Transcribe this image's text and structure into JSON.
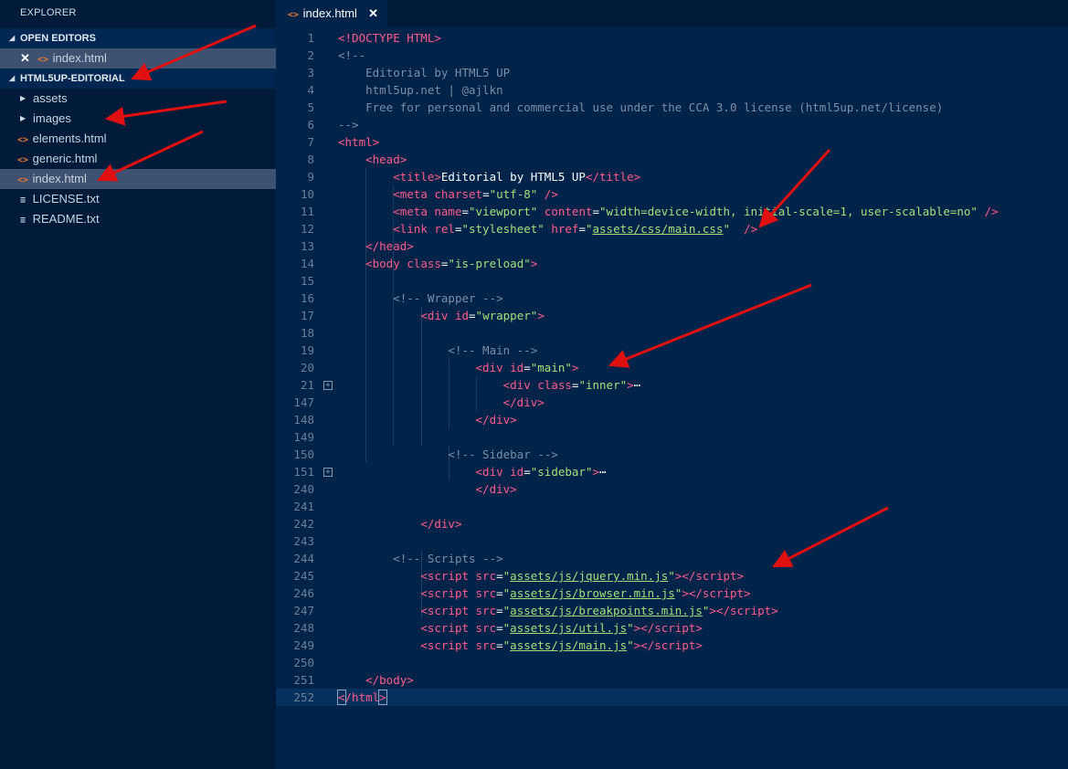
{
  "sidebar": {
    "title": "EXPLORER",
    "open_editors_label": "OPEN EDITORS",
    "open_editor_file": "index.html",
    "project_label": "HTML5UP-EDITORIAL",
    "folders": [
      "assets",
      "images"
    ],
    "files": [
      "elements.html",
      "generic.html",
      "index.html",
      "LICENSE.txt",
      "README.txt"
    ]
  },
  "tab": {
    "label": "index.html",
    "close": "✕"
  },
  "editor": {
    "lines": [
      {
        "n": "1",
        "html": "<span class='tg'>&lt;!DOCTYPE HTML&gt;</span>"
      },
      {
        "n": "2",
        "html": "<span class='cm'>&lt;!--</span>"
      },
      {
        "n": "3",
        "html": "<span class='cm'>    Editorial by HTML5 UP</span>"
      },
      {
        "n": "4",
        "html": "<span class='cm'>    html5up.net | @ajlkn</span>"
      },
      {
        "n": "5",
        "html": "<span class='cm'>    Free for personal and commercial use under the CCA 3.0 license (html5up.net/license)</span>"
      },
      {
        "n": "6",
        "html": "<span class='cm'>--&gt;</span>"
      },
      {
        "n": "7",
        "html": "<span class='tg'>&lt;html&gt;</span>"
      },
      {
        "n": "8",
        "html": "    <span class='tg'>&lt;head&gt;</span>"
      },
      {
        "n": "9",
        "html": "        <span class='tg'>&lt;title&gt;</span><span class='pl'>Editorial by HTML5 UP</span><span class='tg'>&lt;/title&gt;</span>"
      },
      {
        "n": "10",
        "html": "        <span class='tg'>&lt;meta </span><span class='at'>charset</span><span class='pl'>=</span><span class='st'>\"utf-8\"</span><span class='tg'> /&gt;</span>"
      },
      {
        "n": "11",
        "html": "        <span class='tg'>&lt;meta </span><span class='at'>name</span><span class='pl'>=</span><span class='st'>\"viewport\"</span> <span class='at'>content</span><span class='pl'>=</span><span class='st'>\"width=device-width, initial-scale=1, user-scalable=no\"</span><span class='tg'> /&gt;</span>"
      },
      {
        "n": "12",
        "html": "        <span class='tg'>&lt;link </span><span class='at'>rel</span><span class='pl'>=</span><span class='st'>\"stylesheet\"</span> <span class='at'>href</span><span class='pl'>=</span><span class='st'>\"</span><span class='lk'>assets/css/main.css</span><span class='st'>\"</span><span class='tg'>  /&gt;</span>"
      },
      {
        "n": "13",
        "html": "    <span class='tg'>&lt;/head&gt;</span>"
      },
      {
        "n": "14",
        "html": "    <span class='tg'>&lt;body </span><span class='at'>class</span><span class='pl'>=</span><span class='st'>\"is-preload\"</span><span class='tg'>&gt;</span>"
      },
      {
        "n": "15",
        "html": ""
      },
      {
        "n": "16",
        "html": "        <span class='cm'>&lt;!-- Wrapper --&gt;</span>"
      },
      {
        "n": "17",
        "html": "            <span class='tg'>&lt;div </span><span class='at'>id</span><span class='pl'>=</span><span class='st'>\"wrapper\"</span><span class='tg'>&gt;</span>"
      },
      {
        "n": "18",
        "html": ""
      },
      {
        "n": "19",
        "html": "                <span class='cm'>&lt;!-- Main --&gt;</span>"
      },
      {
        "n": "20",
        "html": "                    <span class='tg'>&lt;div </span><span class='at'>id</span><span class='pl'>=</span><span class='st'>\"main\"</span><span class='tg'>&gt;</span>"
      },
      {
        "n": "21",
        "fold": true,
        "html": "                        <span class='tg'>&lt;div </span><span class='at'>class</span><span class='pl'>=</span><span class='st'>\"inner\"</span><span class='tg'>&gt;</span><span class='dt'>⋯</span>"
      },
      {
        "n": "147",
        "html": "                        <span class='tg'>&lt;/div&gt;</span>"
      },
      {
        "n": "148",
        "html": "                    <span class='tg'>&lt;/div&gt;</span>"
      },
      {
        "n": "149",
        "html": ""
      },
      {
        "n": "150",
        "html": "                <span class='cm'>&lt;!-- Sidebar --&gt;</span>"
      },
      {
        "n": "151",
        "fold": true,
        "html": "                    <span class='tg'>&lt;div </span><span class='at'>id</span><span class='pl'>=</span><span class='st'>\"sidebar\"</span><span class='tg'>&gt;</span><span class='dt'>⋯</span>"
      },
      {
        "n": "240",
        "html": "                    <span class='tg'>&lt;/div&gt;</span>"
      },
      {
        "n": "241",
        "html": ""
      },
      {
        "n": "242",
        "html": "            <span class='tg'>&lt;/div&gt;</span>"
      },
      {
        "n": "243",
        "html": ""
      },
      {
        "n": "244",
        "html": "        <span class='cm'>&lt;!-- Scripts --&gt;</span>"
      },
      {
        "n": "245",
        "html": "            <span class='tg'>&lt;script </span><span class='at'>src</span><span class='pl'>=</span><span class='st'>\"</span><span class='lk'>assets/js/jquery.min.js</span><span class='st'>\"</span><span class='tg'>&gt;&lt;/script&gt;</span>"
      },
      {
        "n": "246",
        "html": "            <span class='tg'>&lt;script </span><span class='at'>src</span><span class='pl'>=</span><span class='st'>\"</span><span class='lk'>assets/js/browser.min.js</span><span class='st'>\"</span><span class='tg'>&gt;&lt;/script&gt;</span>"
      },
      {
        "n": "247",
        "html": "            <span class='tg'>&lt;script </span><span class='at'>src</span><span class='pl'>=</span><span class='st'>\"</span><span class='lk'>assets/js/breakpoints.min.js</span><span class='st'>\"</span><span class='tg'>&gt;&lt;/script&gt;</span>"
      },
      {
        "n": "248",
        "html": "            <span class='tg'>&lt;script </span><span class='at'>src</span><span class='pl'>=</span><span class='st'>\"</span><span class='lk'>assets/js/util.js</span><span class='st'>\"</span><span class='tg'>&gt;&lt;/script&gt;</span>"
      },
      {
        "n": "249",
        "html": "            <span class='tg'>&lt;script </span><span class='at'>src</span><span class='pl'>=</span><span class='st'>\"</span><span class='lk'>assets/js/main.js</span><span class='st'>\"</span><span class='tg'>&gt;&lt;/script&gt;</span>"
      },
      {
        "n": "250",
        "html": ""
      },
      {
        "n": "251",
        "html": "    <span class='tg'>&lt;/body&gt;</span>"
      },
      {
        "n": "252",
        "current": true,
        "html": "<span class='tg' style='outline:1px solid #8fa3bb'>&lt;</span><span class='tg'>/html</span><span class='tg' style='outline:1px solid #8fa3bb'>&gt;</span>"
      }
    ]
  },
  "colors": {
    "background": "#00234a",
    "sidebar": "#001b3a",
    "tag": "#ff5c8a",
    "string": "#a2e07a",
    "comment": "#7d8ea5",
    "annotation_arrow": "#e01010"
  }
}
